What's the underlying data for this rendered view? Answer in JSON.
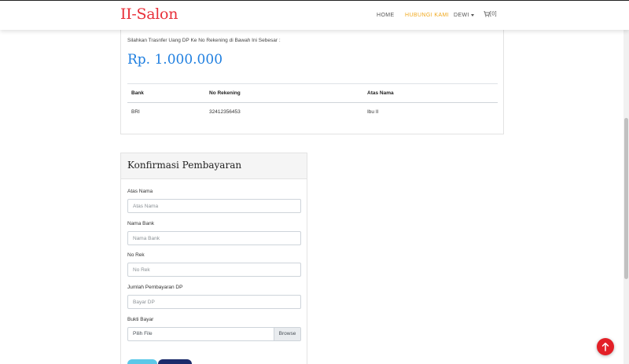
{
  "navbar": {
    "brand": "II-Salon",
    "items": [
      {
        "label": "HOME"
      },
      {
        "label": "HUBUNGI KAMI",
        "active": true
      },
      {
        "label": "DEWI"
      }
    ],
    "cart": "[0]"
  },
  "payment": {
    "note": "Silahkan Trasnfer Uang DP Ke No Rekening di Bawah Ini Sebesar :",
    "amount": "Rp. 1.000.000",
    "table": {
      "headers": [
        "Bank",
        "No Rekening",
        "Atas Nama"
      ],
      "rows": [
        [
          "BRI",
          "32412356453",
          "Ibu II"
        ]
      ]
    }
  },
  "confirm_form": {
    "title": "Konfirmasi Pembayaran",
    "fields": [
      {
        "label": "Atas Nama",
        "placeholder": "Atas Nama"
      },
      {
        "label": "Nama Bank",
        "placeholder": "Nama Bank"
      },
      {
        "label": "No Rek",
        "placeholder": "No Rek"
      },
      {
        "label": "Jumlah Pembayaran DP",
        "placeholder": "Bayar DP"
      }
    ],
    "file": {
      "label": "Bukti Bayar",
      "placeholder": "Pilih File",
      "browse": "Browse"
    }
  },
  "colors": {
    "brand": "#e8303a",
    "active_nav": "#f0a81c",
    "amount": "#1f7fe0",
    "back_to_top": "#e32027"
  },
  "icons": {
    "cart": "cart-icon",
    "back_to_top": "arrow-up-icon"
  }
}
